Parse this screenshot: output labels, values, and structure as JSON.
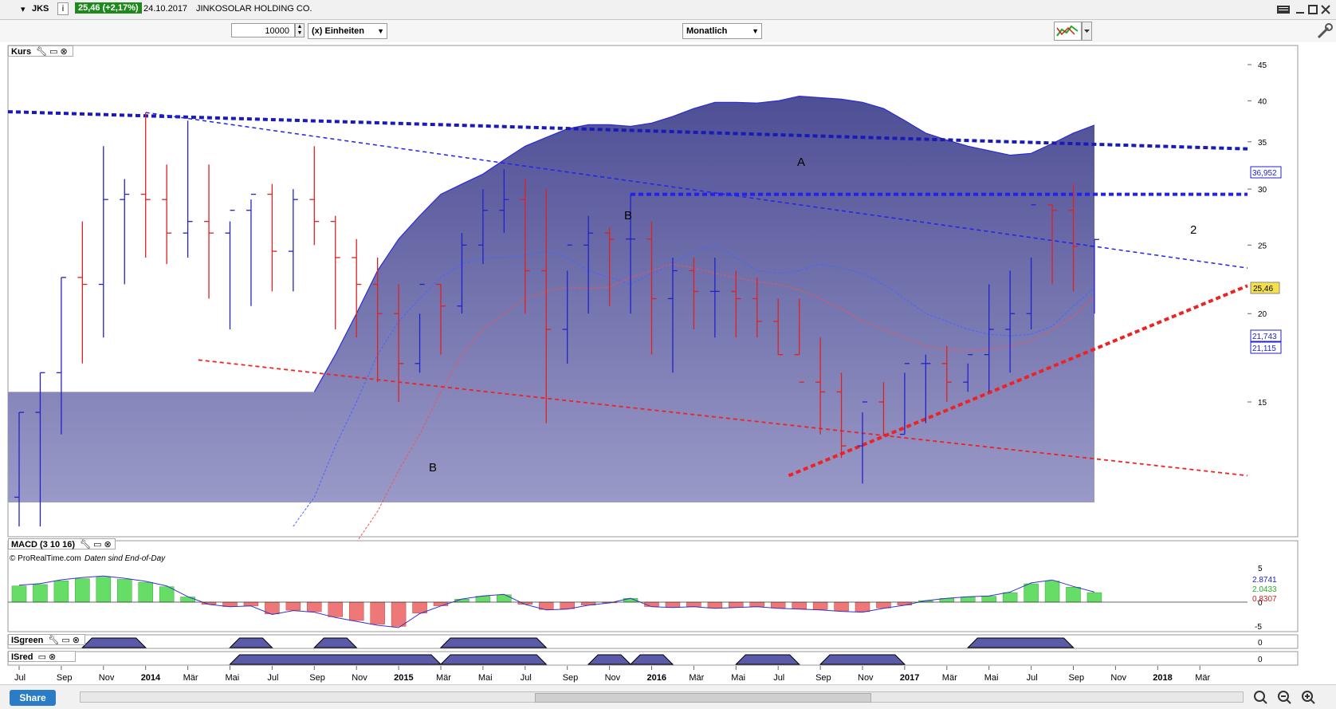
{
  "header": {
    "symbol": "JKS",
    "info_icon": "i",
    "price_badge": "25,46 (+2,17%)",
    "date": "24.10.2017",
    "company": "JINKOSOLAR HOLDING CO."
  },
  "toolbar": {
    "quantity": "10000",
    "units_label": "(x) Einheiten",
    "period_label": "Monatlich"
  },
  "panels": {
    "price_label": "Kurs",
    "macd_label": "MACD (3 10 16)",
    "isgreen_label": "ISgreen",
    "isred_label": "ISred",
    "copyright": "© ProRealTime.com",
    "eod_note": "Daten sind End-of-Day"
  },
  "annotations": {
    "a": "A",
    "b_top": "B",
    "b_bottom": "B",
    "two": "2"
  },
  "price_axis": {
    "ticks": [
      "45",
      "40",
      "35",
      "30",
      "25",
      "20",
      "15"
    ],
    "badges": {
      "upper": "36,952",
      "last": "25,46",
      "ma1": "21,743",
      "ma2": "21,115"
    }
  },
  "macd_axis": {
    "ticks": [
      "5",
      "0",
      "-5"
    ],
    "badges": {
      "v1": "2.8741",
      "v2": "2.0433",
      "v3": "0.8307"
    }
  },
  "is_axis": {
    "green": "0",
    "red": "0"
  },
  "x_axis": {
    "labels": [
      "Jul",
      "Sep",
      "Nov",
      "2014",
      "Mär",
      "Mai",
      "Jul",
      "Sep",
      "Nov",
      "2015",
      "Mär",
      "Mai",
      "Jul",
      "Sep",
      "Nov",
      "2016",
      "Mär",
      "Mai",
      "Jul",
      "Sep",
      "Nov",
      "2017",
      "Mär",
      "Mai",
      "Jul",
      "Sep",
      "Nov",
      "2018",
      "Mär"
    ]
  },
  "share_label": "Share",
  "colors": {
    "up": "#2222cc",
    "down": "#dd2222",
    "area": "#5a5aa0",
    "macd_up": "#66dd66",
    "macd_down": "#ee7777"
  },
  "chart_data": {
    "type": "ohlc",
    "period": "monthly",
    "x": [
      "2013-07",
      "2013-08",
      "2013-09",
      "2013-10",
      "2013-11",
      "2013-12",
      "2014-01",
      "2014-02",
      "2014-03",
      "2014-04",
      "2014-05",
      "2014-06",
      "2014-07",
      "2014-08",
      "2014-09",
      "2014-10",
      "2014-11",
      "2014-12",
      "2015-01",
      "2015-02",
      "2015-03",
      "2015-04",
      "2015-05",
      "2015-06",
      "2015-07",
      "2015-08",
      "2015-09",
      "2015-10",
      "2015-11",
      "2015-12",
      "2016-01",
      "2016-02",
      "2016-03",
      "2016-04",
      "2016-05",
      "2016-06",
      "2016-07",
      "2016-08",
      "2016-09",
      "2016-10",
      "2016-11",
      "2016-12",
      "2017-01",
      "2017-02",
      "2017-03",
      "2017-04",
      "2017-05",
      "2017-06",
      "2017-07",
      "2017-08",
      "2017-09",
      "2017-10"
    ],
    "open": [
      11.0,
      14.5,
      16.5,
      22.5,
      22.0,
      29.0,
      29.5,
      29.0,
      26.0,
      27.0,
      26.0,
      28.0,
      29.5,
      24.5,
      29.0,
      27.0,
      24.0,
      22.0,
      20.0,
      17.0,
      22.0,
      20.5,
      25.0,
      28.0,
      29.0,
      23.0,
      19.0,
      25.0,
      26.0,
      25.5,
      25.5,
      21.0,
      23.0,
      21.5,
      21.5,
      21.0,
      19.5,
      17.5,
      16.0,
      15.5,
      13.0,
      15.0,
      13.5,
      17.0,
      17.0,
      16.0,
      17.5,
      19.0,
      20.0,
      28.5,
      28.0,
      24.9
    ],
    "high": [
      14.5,
      16.5,
      22.5,
      27.0,
      34.5,
      31.0,
      38.5,
      32.5,
      37.5,
      32.5,
      27.0,
      29.0,
      30.5,
      30.0,
      34.5,
      27.5,
      25.5,
      24.0,
      22.0,
      20.0,
      22.0,
      26.0,
      30.0,
      32.0,
      31.0,
      30.0,
      23.0,
      27.5,
      26.5,
      29.5,
      27.0,
      24.0,
      24.0,
      24.0,
      23.0,
      22.5,
      21.0,
      21.0,
      18.5,
      16.5,
      14.5,
      16.0,
      16.5,
      17.5,
      18.0,
      17.0,
      22.0,
      23.0,
      24.0,
      28.5,
      30.5,
      25.5
    ],
    "low": [
      10.0,
      10.0,
      13.5,
      17.0,
      18.5,
      22.0,
      24.0,
      23.5,
      24.0,
      21.0,
      19.0,
      20.5,
      21.5,
      21.5,
      25.0,
      19.0,
      18.5,
      16.0,
      15.0,
      16.5,
      17.5,
      20.0,
      23.5,
      26.0,
      20.0,
      14.0,
      17.0,
      20.0,
      20.5,
      20.0,
      17.5,
      16.5,
      19.0,
      18.5,
      18.5,
      18.5,
      17.5,
      17.5,
      13.5,
      12.5,
      11.5,
      13.5,
      13.5,
      14.0,
      15.0,
      15.5,
      15.5,
      16.5,
      19.0,
      22.0,
      21.5,
      20.0
    ],
    "close": [
      14.5,
      16.5,
      22.5,
      22.0,
      29.0,
      29.5,
      29.0,
      26.0,
      27.0,
      26.0,
      28.0,
      29.5,
      24.5,
      29.0,
      27.0,
      24.0,
      22.0,
      20.0,
      17.0,
      22.0,
      20.5,
      25.0,
      28.0,
      29.0,
      23.0,
      19.0,
      25.0,
      26.0,
      25.5,
      25.5,
      21.0,
      23.0,
      21.5,
      21.5,
      21.0,
      19.5,
      17.5,
      16.0,
      15.5,
      13.0,
      15.0,
      13.5,
      17.0,
      17.0,
      16.0,
      17.5,
      19.0,
      20.0,
      28.5,
      28.0,
      24.9,
      25.46
    ],
    "upper_band": [
      15.5,
      17.5,
      20.0,
      23.0,
      25.5,
      27.5,
      29.5,
      30.5,
      31.5,
      33.0,
      34.5,
      35.5,
      36.5,
      37.0,
      37.0,
      36.8,
      37.2,
      38.0,
      39.0,
      39.8,
      39.8,
      39.7,
      40.0,
      40.6,
      40.4,
      40.2,
      39.8,
      39.0,
      37.5,
      36.0,
      35.2,
      34.5,
      34.0,
      33.5,
      33.7,
      34.8,
      36.0,
      36.952
    ],
    "ma_fast": [
      10.0,
      11.0,
      13.0,
      15.0,
      17.5,
      19.5,
      21.0,
      22.5,
      23.5,
      24.0,
      24.0,
      24.2,
      24.5,
      24.0,
      23.0,
      22.5,
      22.0,
      22.8,
      23.5,
      24.5,
      25.0,
      24.0,
      23.0,
      22.8,
      23.0,
      23.5,
      23.2,
      22.8,
      22.0,
      21.0,
      20.0,
      19.5,
      19.0,
      18.7,
      18.6,
      18.7,
      19.2,
      20.5,
      21.743
    ],
    "ma_slow": [
      9.5,
      10.5,
      12.0,
      13.5,
      15.5,
      17.5,
      19.0,
      20.0,
      21.0,
      21.5,
      21.8,
      21.7,
      21.8,
      22.5,
      23.0,
      23.5,
      23.2,
      22.8,
      22.5,
      22.2,
      22.0,
      21.6,
      21.0,
      20.3,
      19.5,
      19.0,
      18.5,
      18.0,
      17.8,
      17.7,
      17.8,
      18.0,
      18.3,
      19.0,
      19.8,
      21.115
    ],
    "macd_hist": [
      2.2,
      2.4,
      2.9,
      3.2,
      3.4,
      3.1,
      2.7,
      2.1,
      0.7,
      -0.3,
      -0.6,
      -0.5,
      -1.6,
      -1.1,
      -1.3,
      -2.0,
      -2.5,
      -3.0,
      -3.3,
      -1.5,
      -0.5,
      0.4,
      0.8,
      1.0,
      -0.3,
      -1.0,
      -0.9,
      -0.4,
      -0.1,
      0.5,
      -0.6,
      -0.7,
      -0.6,
      -0.8,
      -0.7,
      -0.6,
      -0.8,
      -0.9,
      -1.0,
      -1.2,
      -1.3,
      -0.8,
      -0.4,
      0.2,
      0.5,
      0.7,
      0.8,
      1.3,
      2.5,
      2.8741,
      2.0433,
      1.3
    ],
    "macd_range": [
      -5,
      5
    ],
    "isgreen_active": [
      [
        3,
        6
      ],
      [
        10,
        12
      ],
      [
        14,
        16
      ],
      [
        20,
        25
      ],
      [
        45,
        50
      ]
    ],
    "isred_active": [
      [
        10,
        20
      ],
      [
        20,
        25
      ],
      [
        27,
        29
      ],
      [
        29,
        31
      ],
      [
        34,
        37
      ],
      [
        38,
        42
      ]
    ],
    "lines": {
      "A": "downward sloping resistance (thick blue dashed)",
      "B_upper": "downward sloping trend (thin blue dashed)",
      "B_lower": "downward sloping support (thin red dashed)",
      "level_2": 29.5,
      "uptrend": "rising support (thick red dashed)"
    },
    "ylim": [
      12,
      47
    ],
    "yscale": "log"
  }
}
